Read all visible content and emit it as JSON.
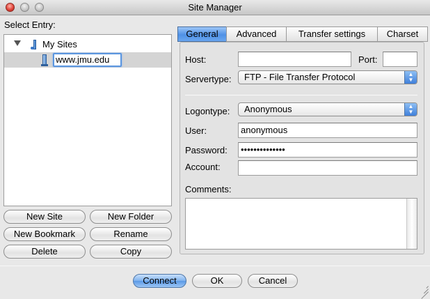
{
  "window": {
    "title": "Site Manager"
  },
  "left": {
    "select_entry_label": "Select Entry:",
    "tree": {
      "root_label": "My Sites",
      "child_rename_value": "www.jmu.edu"
    },
    "buttons": {
      "new_site": "New Site",
      "new_folder": "New Folder",
      "new_bookmark": "New Bookmark",
      "rename": "Rename",
      "delete": "Delete",
      "copy": "Copy"
    }
  },
  "tabs": [
    "General",
    "Advanced",
    "Transfer settings",
    "Charset"
  ],
  "general": {
    "host_label": "Host:",
    "host_value": "",
    "port_label": "Port:",
    "port_value": "",
    "servertype_label": "Servertype:",
    "servertype_value": "FTP - File Transfer Protocol",
    "logontype_label": "Logontype:",
    "logontype_value": "Anonymous",
    "user_label": "User:",
    "user_value": "anonymous",
    "password_label": "Password:",
    "password_value": "••••••••••••••",
    "account_label": "Account:",
    "account_value": "",
    "comments_label": "Comments:",
    "comments_value": ""
  },
  "footer": {
    "connect": "Connect",
    "ok": "OK",
    "cancel": "Cancel"
  },
  "colors": {
    "accent": "#5a99e6",
    "window_bg": "#e8e8e8"
  }
}
